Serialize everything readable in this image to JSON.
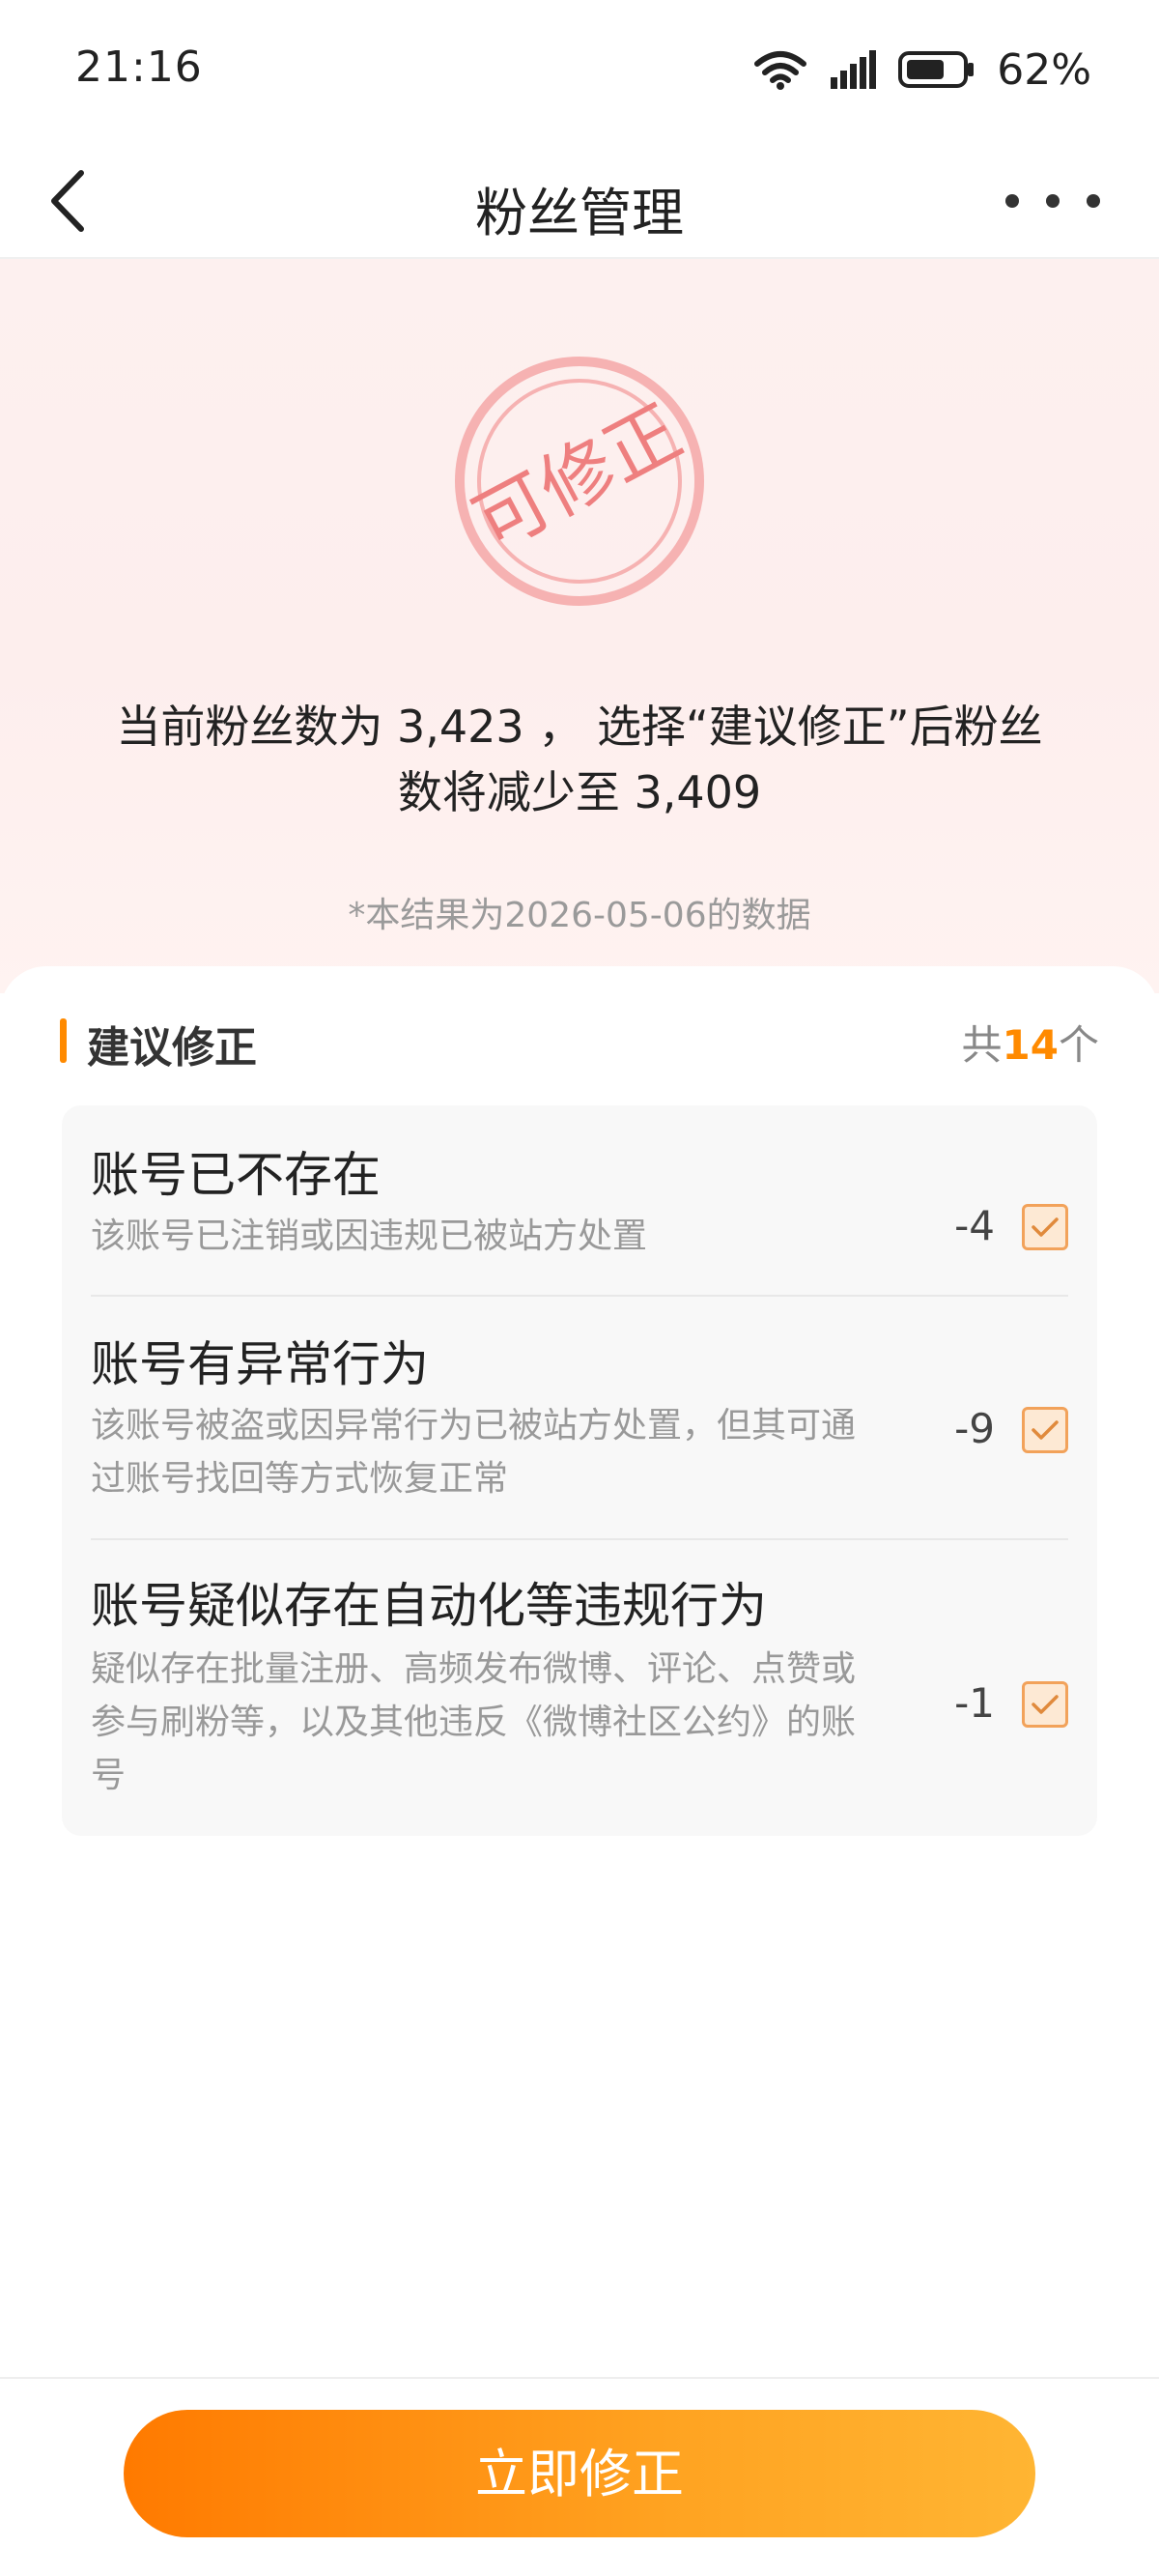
{
  "status_bar": {
    "time": "21:16",
    "battery": "62%",
    "icons": [
      "wifi-icon",
      "signal-icon",
      "battery-icon"
    ]
  },
  "nav": {
    "title": "粉丝管理",
    "back_icon": "chevron-left-icon",
    "more_icon": "more-horizontal-icon"
  },
  "hero": {
    "stamp_text": "可修正",
    "desc_line1": "当前粉丝数为 3,423 ， 选择“建议修正”后粉丝",
    "desc_line2": "数将减少至 3,409",
    "note": "*本结果为2026-05-06的数据"
  },
  "section": {
    "title": "建议修正",
    "count_prefix": "共",
    "count_value": "14",
    "count_suffix": "个"
  },
  "items": [
    {
      "title": "账号已不存在",
      "desc": "该账号已注销或因违规已被站方处置",
      "count": "-4",
      "checked": true
    },
    {
      "title": "账号有异常行为",
      "desc": "该账号被盗或因异常行为已被站方处置，但其可通过账号找回等方式恢复正常",
      "count": "-9",
      "checked": true
    },
    {
      "title": "账号疑似存在自动化等违规行为",
      "desc": "疑似存在批量注册、高频发布微博、评论、点赞或参与刷粉等，以及其他违反《微博社区公约》的账号",
      "count": "-1",
      "checked": true
    }
  ],
  "bottom": {
    "button_label": "立即修正"
  },
  "colors": {
    "accent": "#ff8a00",
    "stamp": "#f08a8a",
    "hero_bg": "#fdeeed"
  }
}
